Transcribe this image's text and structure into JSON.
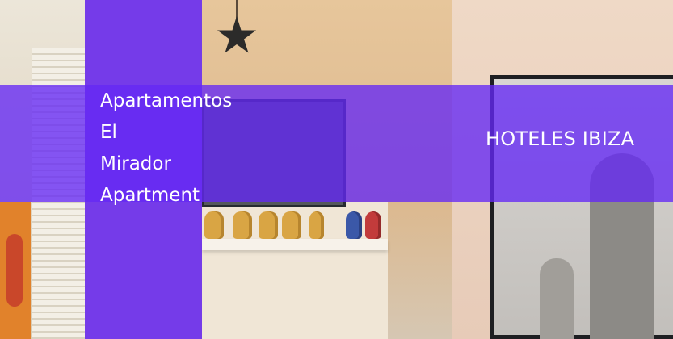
{
  "hotel": {
    "name_lines": [
      "Apartamentos",
      "El",
      "Mirador",
      "Apartment"
    ]
  },
  "category_link": {
    "label": "HOTELES IBIZA"
  },
  "colors": {
    "overlay_purple": "#5b1af5",
    "text": "#ffffff"
  }
}
